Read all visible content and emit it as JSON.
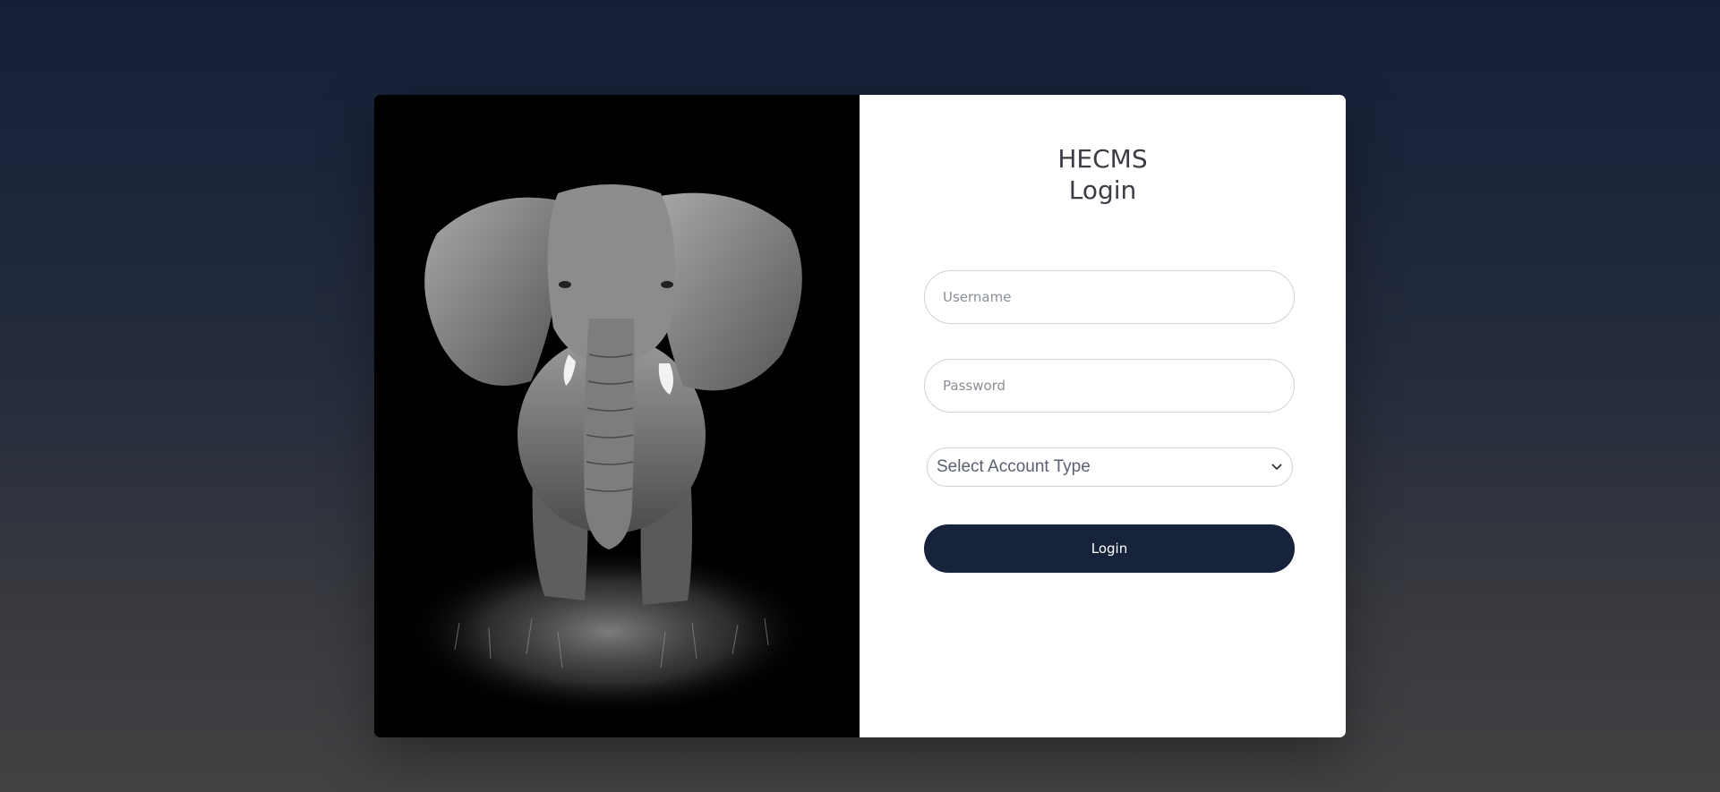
{
  "brand": {
    "name": "HECMS",
    "subtitle": "Login"
  },
  "form": {
    "username_placeholder": "Username",
    "password_placeholder": "Password",
    "account_type_selected": "Select Account Type",
    "login_label": "Login"
  },
  "colors": {
    "primary": "#17223b",
    "background_top": "#151f38",
    "background_bottom": "#424244"
  }
}
